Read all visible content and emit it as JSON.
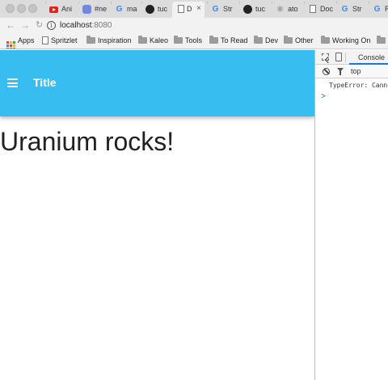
{
  "browser": {
    "tabs": [
      {
        "label": "Ani",
        "favicon": "youtube-icon"
      },
      {
        "label": "#ne",
        "favicon": "discord-icon"
      },
      {
        "label": "ma",
        "favicon": "google-icon"
      },
      {
        "label": "tuc",
        "favicon": "github-icon"
      },
      {
        "label": "D",
        "favicon": "document-icon",
        "active": true
      },
      {
        "label": "Str",
        "favicon": "google-icon"
      },
      {
        "label": "tuc",
        "favicon": "github-icon"
      },
      {
        "label": "ato",
        "favicon": "atom-icon"
      },
      {
        "label": "Doc",
        "favicon": "document-icon"
      },
      {
        "label": "Str",
        "favicon": "google-icon"
      },
      {
        "label": "R",
        "favicon": "google-icon"
      }
    ],
    "tab_close_glyph": "×",
    "address": {
      "host": "localhost",
      "port": ":8080"
    },
    "bookmarks": [
      {
        "label": "Apps",
        "icon": "apps-grid-icon"
      },
      {
        "label": "Spritzlet",
        "icon": "document-icon"
      },
      {
        "label": "Inspiration",
        "icon": "folder-icon"
      },
      {
        "label": "Kaleo",
        "icon": "folder-icon"
      },
      {
        "label": "Tools",
        "icon": "folder-icon"
      },
      {
        "label": "To Read",
        "icon": "folder-icon"
      },
      {
        "label": "Dev",
        "icon": "folder-icon"
      },
      {
        "label": "Other",
        "icon": "folder-icon"
      },
      {
        "label": "Working On",
        "icon": "folder-icon"
      }
    ]
  },
  "app": {
    "title": "Title",
    "headline": "Uranium rocks!",
    "app_bar_color": "#38bdf0"
  },
  "devtools": {
    "tab": "Console",
    "context": "top",
    "message": "TypeError: Canno",
    "prompt": ">"
  },
  "colors": {
    "tab_strip": "#dcdcdc",
    "toolbar": "#f2f2f2",
    "link_blue": "#1a73e8",
    "apps_grid": [
      "#ea4335",
      "#fbbc05",
      "#34a853",
      "#4285f4",
      "#ea4335",
      "#fbbc05",
      "#34a853",
      "#4285f4",
      "#ea4335"
    ]
  }
}
